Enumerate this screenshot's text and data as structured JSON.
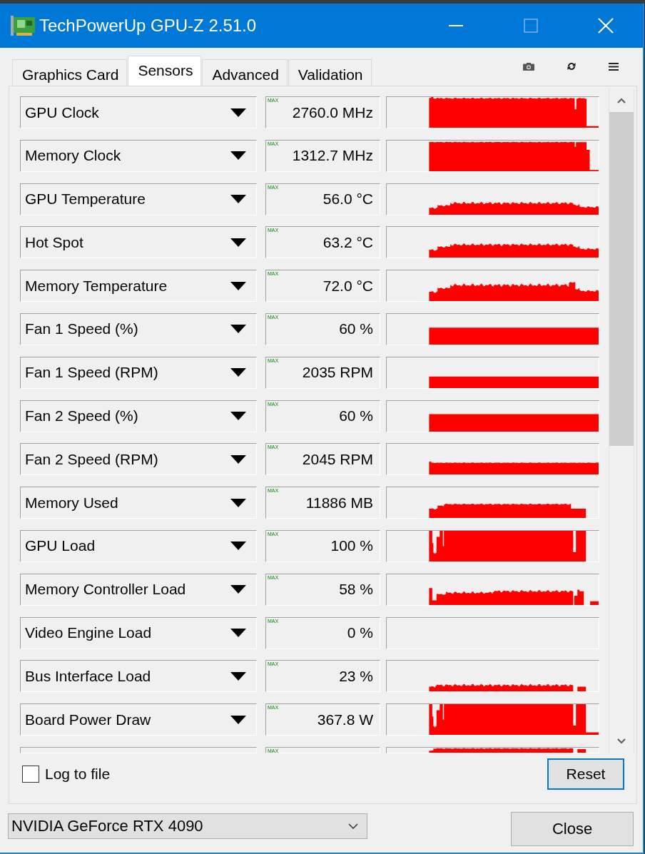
{
  "window": {
    "title": "TechPowerUp GPU-Z 2.51.0",
    "caption_buttons": [
      {
        "kind": "minimize",
        "disabled": false
      },
      {
        "kind": "maximize",
        "disabled": true
      },
      {
        "kind": "close",
        "disabled": false
      }
    ]
  },
  "tabs": [
    {
      "label": "Graphics Card",
      "selected": false
    },
    {
      "label": "Sensors",
      "selected": true
    },
    {
      "label": "Advanced",
      "selected": false
    },
    {
      "label": "Validation",
      "selected": false
    }
  ],
  "toolbar": [
    {
      "kind": "screenshot"
    },
    {
      "kind": "refresh"
    },
    {
      "kind": "menu"
    }
  ],
  "sensors": [
    {
      "name": "GPU Clock",
      "mode_label": "MAX",
      "value": "2760.0 MHz"
    },
    {
      "name": "Memory Clock",
      "mode_label": "MAX",
      "value": "1312.7 MHz"
    },
    {
      "name": "GPU Temperature",
      "mode_label": "MAX",
      "value": "56.0 °C"
    },
    {
      "name": "Hot Spot",
      "mode_label": "MAX",
      "value": "63.2 °C"
    },
    {
      "name": "Memory Temperature",
      "mode_label": "MAX",
      "value": "72.0 °C"
    },
    {
      "name": "Fan 1 Speed (%)",
      "mode_label": "MAX",
      "value": "60 %"
    },
    {
      "name": "Fan 1 Speed (RPM)",
      "mode_label": "MAX",
      "value": "2035 RPM"
    },
    {
      "name": "Fan 2 Speed (%)",
      "mode_label": "MAX",
      "value": "60 %"
    },
    {
      "name": "Fan 2 Speed (RPM)",
      "mode_label": "MAX",
      "value": "2045 RPM"
    },
    {
      "name": "Memory Used",
      "mode_label": "MAX",
      "value": "11886 MB"
    },
    {
      "name": "GPU Load",
      "mode_label": "MAX",
      "value": "100 %"
    },
    {
      "name": "Memory Controller Load",
      "mode_label": "MAX",
      "value": "58 %"
    },
    {
      "name": "Video Engine Load",
      "mode_label": "MAX",
      "value": "0 %"
    },
    {
      "name": "Bus Interface Load",
      "mode_label": "MAX",
      "value": "23 %"
    },
    {
      "name": "Board Power Draw",
      "mode_label": "MAX",
      "value": "367.8 W"
    },
    {
      "mode_label": "MAX"
    }
  ],
  "log_to_file": {
    "label": "Log to file",
    "checked": false
  },
  "reset_button": {
    "label": "Reset",
    "focused": true
  },
  "gpu_select": {
    "value": "NVIDIA GeForce RTX 4090"
  },
  "close_button": {
    "label": "Close"
  }
}
